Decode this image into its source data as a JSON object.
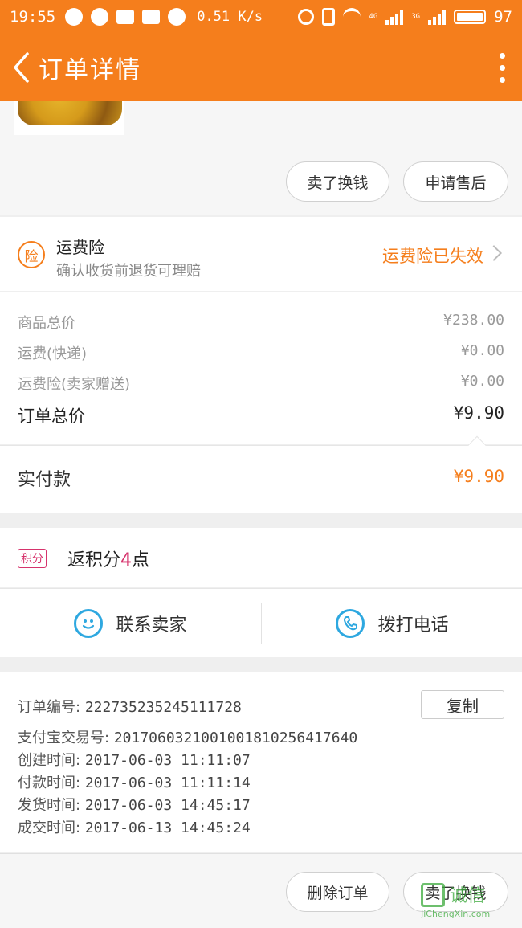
{
  "status_bar": {
    "time": "19:55",
    "net_speed": "0.51 K/s",
    "signal_a": "4G",
    "signal_b": "3G",
    "battery": "97"
  },
  "header": {
    "title": "订单详情",
    "back_icon": "chevron-left-icon",
    "more_icon": "more-vertical-icon",
    "background": "#f57e1c"
  },
  "top_actions": {
    "sell_label": "卖了换钱",
    "after_sale_label": "申请售后"
  },
  "insurance": {
    "badge": "险",
    "title": "运费险",
    "subtitle": "确认收货前退货可理赔",
    "status": "运费险已失效"
  },
  "price": {
    "rows": [
      {
        "label": "商品总价",
        "value": "¥238.00"
      },
      {
        "label": "运费(快递)",
        "value": "¥0.00"
      },
      {
        "label": "运费险(卖家赠送)",
        "value": "¥0.00"
      }
    ],
    "total_label": "订单总价",
    "total_value": "¥9.90",
    "paid_label": "实付款",
    "paid_value": "¥9.90"
  },
  "points": {
    "badge": "积分",
    "prefix": "返积分",
    "number": "4",
    "suffix": "点"
  },
  "contact": {
    "seller_label": "联系卖家",
    "call_label": "拨打电话"
  },
  "order_info": {
    "copy_label": "复制",
    "rows": [
      {
        "label": "订单编号:",
        "value": "222735235245111728"
      },
      {
        "label": "支付宝交易号:",
        "value": "2017060321001001810256417640"
      },
      {
        "label": "创建时间:",
        "value": "2017-06-03 11:11:07"
      },
      {
        "label": "付款时间:",
        "value": "2017-06-03 11:11:14"
      },
      {
        "label": "发货时间:",
        "value": "2017-06-03 14:45:17"
      },
      {
        "label": "成交时间:",
        "value": "2017-06-13 14:45:24"
      }
    ]
  },
  "bottom_actions": {
    "delete_label": "删除订单",
    "sell_label": "卖了换钱"
  },
  "watermark": {
    "text": "诚信",
    "url": "JiChengXin.com"
  }
}
